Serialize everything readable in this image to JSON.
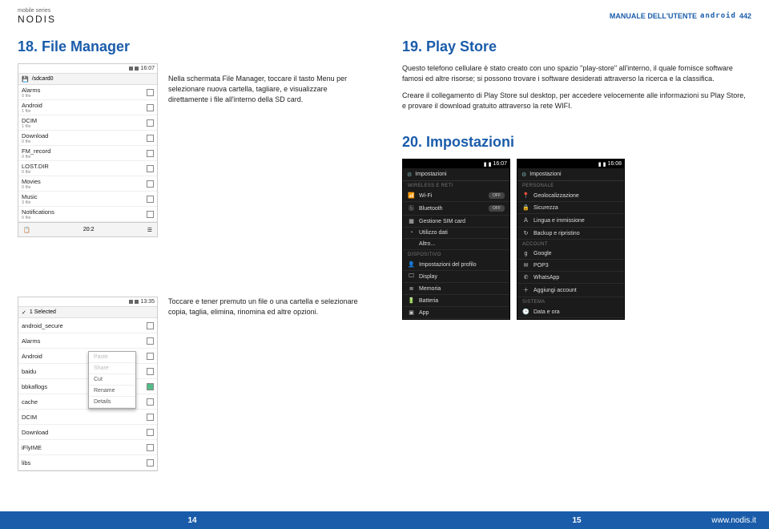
{
  "header": {
    "series": "mobile series",
    "brand": "NODIS",
    "manual": "MANUALE DELL'UTENTE",
    "os": "android",
    "device": "442"
  },
  "left": {
    "section18_title": "18. File Manager",
    "section18_body": "Nella schermata File Manager, toccare il tasto Menu per selezionare nuova cartella, tagliare, e visualizzare direttamente i file all'interno della SD card.",
    "fm2_body": "Toccare e tener premuto un file o una cartella e selezionare copia, taglia, elimina, rinomina ed altre opzioni.",
    "fm1": {
      "clock": "16:07",
      "path": "/sdcard0",
      "items": [
        {
          "name": "Alarms",
          "sub": "0 file"
        },
        {
          "name": "Android",
          "sub": "1 file"
        },
        {
          "name": "DCIM",
          "sub": "1 file"
        },
        {
          "name": "Download",
          "sub": "0 file"
        },
        {
          "name": "FM_record",
          "sub": "0 file"
        },
        {
          "name": "LOST.DIR",
          "sub": "0 file"
        },
        {
          "name": "Movies",
          "sub": "0 file"
        },
        {
          "name": "Music",
          "sub": "3 file"
        },
        {
          "name": "Notifications",
          "sub": "0 file"
        }
      ],
      "bottom_left_icon": "paste",
      "bottom_label": "20:2",
      "bottom_right_icon": "menu"
    },
    "fm2": {
      "clock": "13:35",
      "selected": "1 Selected",
      "items": [
        {
          "name": "android_secure",
          "checked": false
        },
        {
          "name": "Alarms",
          "checked": false
        },
        {
          "name": "Android",
          "checked": false
        },
        {
          "name": "baidu",
          "checked": false
        },
        {
          "name": "bbkaflogs",
          "checked": true
        },
        {
          "name": "cache",
          "checked": false
        },
        {
          "name": "DCIM",
          "checked": false
        },
        {
          "name": "Download",
          "checked": false
        },
        {
          "name": "iFlyIME",
          "checked": false
        },
        {
          "name": "libs",
          "checked": false
        }
      ],
      "menu": [
        "Paste",
        "Share",
        "Cut",
        "Rename",
        "Details"
      ]
    }
  },
  "right": {
    "section19_title": "19. Play Store",
    "section19_p1": "Questo telefono cellulare è stato creato con uno spazio \"play-store\" all'interno, il quale fornisce software famosi ed altre risorse; si possono trovare i software desiderati attraverso la ricerca e la classifica.",
    "section19_p2": "Creare il collegamento di Play Store sul desktop, per accedere velocemente alle informazioni su Play Store, e provare il download gratuito attraverso la rete WIFI.",
    "section20_title": "20. Impostazioni",
    "settings1": {
      "clock": "16:07",
      "title": "Impostazioni",
      "sections": [
        {
          "cat": "WIRELESS E RETI",
          "items": [
            {
              "icon": "📶",
              "label": "Wi-Fi",
              "ctrl": "OFF"
            },
            {
              "icon": "ⓑ",
              "label": "Bluetooth",
              "ctrl": "OFF"
            },
            {
              "icon": "▦",
              "label": "Gestione SIM card"
            },
            {
              "icon": "◔",
              "label": "Utilizzo dati"
            },
            {
              "icon": "",
              "label": "Altro..."
            }
          ]
        },
        {
          "cat": "DISPOSITIVO",
          "items": [
            {
              "icon": "👤",
              "label": "Impostazioni del profilo"
            },
            {
              "icon": "🖵",
              "label": "Display"
            },
            {
              "icon": "≣",
              "label": "Memoria"
            },
            {
              "icon": "🔋",
              "label": "Batteria"
            },
            {
              "icon": "▣",
              "label": "App"
            }
          ]
        }
      ]
    },
    "settings2": {
      "clock": "16:08",
      "title": "Impostazioni",
      "sections": [
        {
          "cat": "PERSONALE",
          "items": [
            {
              "icon": "📍",
              "label": "Geolocalizzazione"
            },
            {
              "icon": "🔒",
              "label": "Sicurezza"
            },
            {
              "icon": "Ａ",
              "label": "Lingua e immissione"
            },
            {
              "icon": "↻",
              "label": "Backup e ripristino"
            }
          ]
        },
        {
          "cat": "ACCOUNT",
          "items": [
            {
              "icon": "g",
              "label": "Google"
            },
            {
              "icon": "✉",
              "label": "POP3"
            },
            {
              "icon": "✆",
              "label": "WhatsApp"
            },
            {
              "icon": "＋",
              "label": "Aggiungi account"
            }
          ]
        },
        {
          "cat": "SISTEMA",
          "items": [
            {
              "icon": "🕒",
              "label": "Data e ora"
            }
          ]
        }
      ]
    }
  },
  "footer": {
    "left_page": "14",
    "right_page": "15",
    "site": "www.nodis.it"
  }
}
